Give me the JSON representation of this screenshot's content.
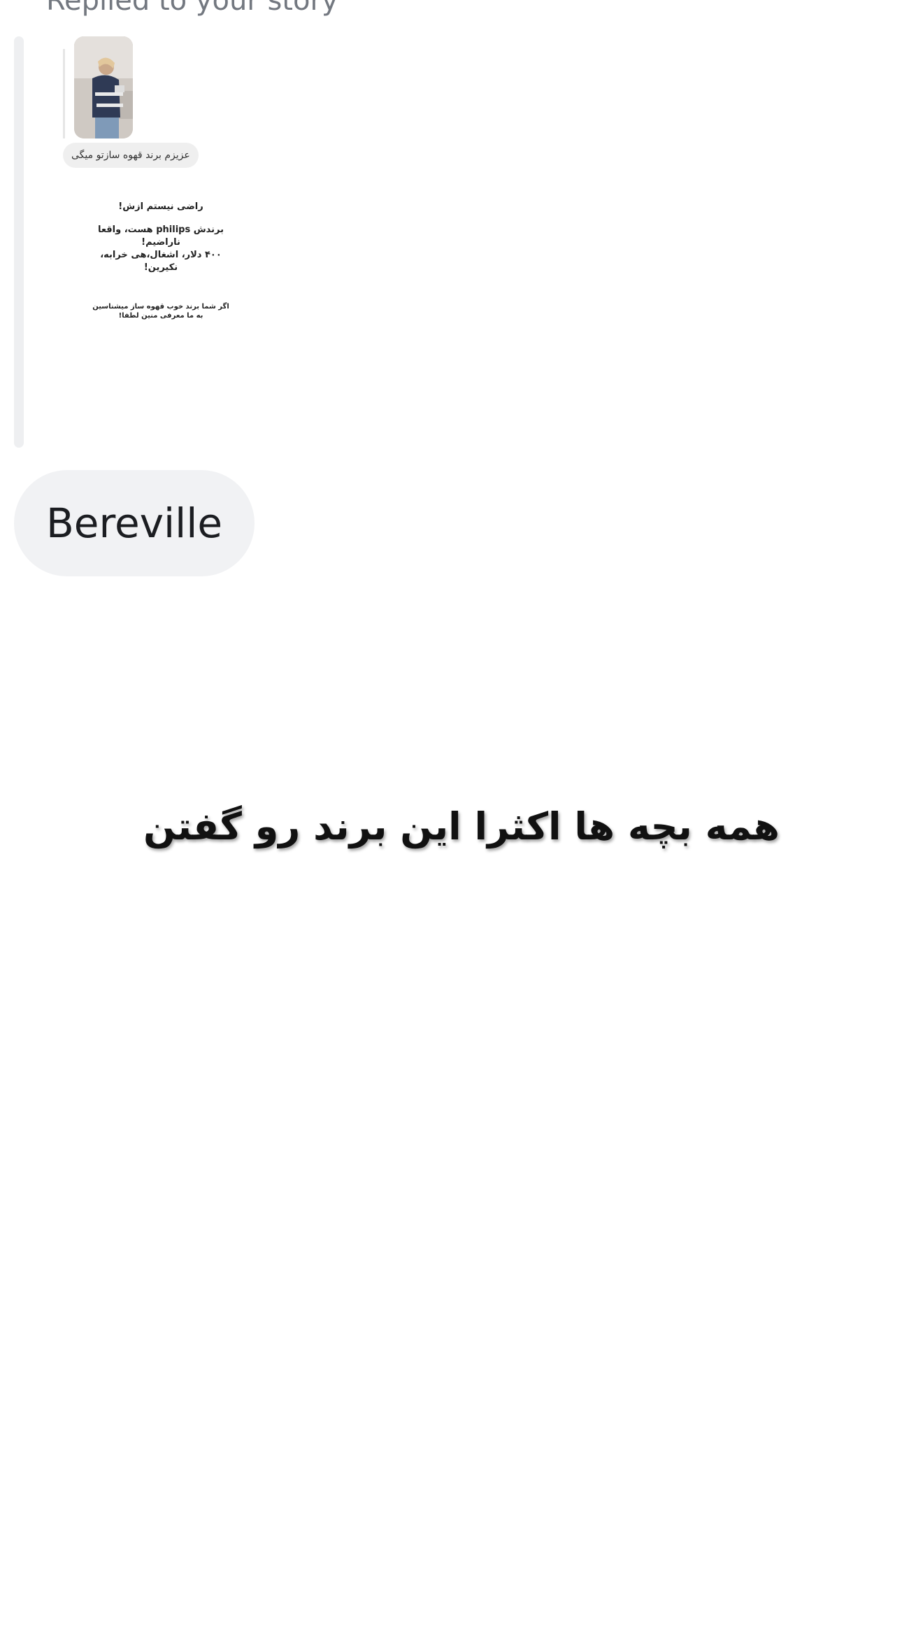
{
  "thread": {
    "reply_label": "Replied to your story",
    "story": {
      "chip_text": "عزیزم برند قهوه سازتو میگی",
      "line1": "راضی نیستم ازش!",
      "line2a": "برندش philips هست، واقعا ناراضیم!",
      "line2b": "۴۰۰ دلار، اشغال،هی خرابه، نکیرین!",
      "line3a": "اگر شما برند خوب قهوه ساز میشناسین",
      "line3b": "به ما معرفی منین لطفا!"
    },
    "message": {
      "text": "Bereville"
    }
  },
  "overlay": {
    "caption": "همه بچه ها اکثرا این برند رو گفتن"
  }
}
